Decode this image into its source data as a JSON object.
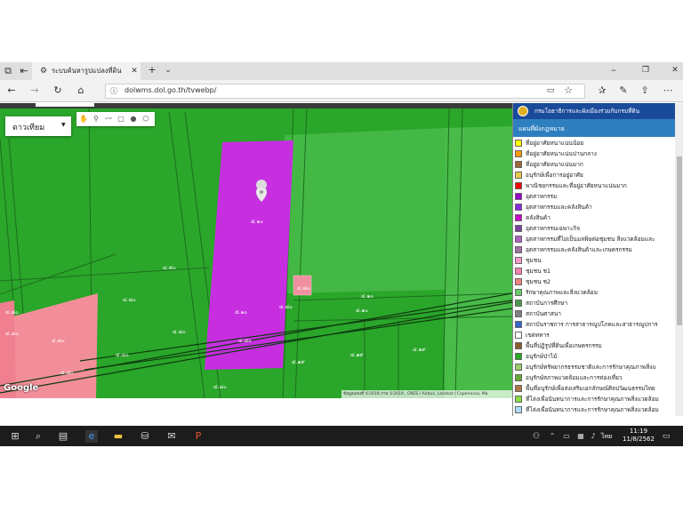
{
  "browser": {
    "tab_title": "ระบบค้นหารูปแปลงที่ดิน",
    "url": "dolwms.dol.go.th/tvwebp/"
  },
  "map": {
    "map_type_label": "ดาวเทียม",
    "google_label": "Google",
    "attribution": "ข้อมูลแผนที่ ©2019 ภาพ ©2019 , CNES / Airbus, Landsat / Copernicus, Ma",
    "plot_labels": [
      "๕.๑๐",
      "๔.๕๐",
      "๕.๑๐",
      "๔.๘๐",
      "๔.๘๐",
      "๔.๑๐",
      "๔.๑๐",
      "๔.๑๙",
      "๔.๑๙",
      "๔.๑๙",
      "๔.๑๙",
      "๔.๘๐",
      "๔.๘๐",
      "๔.๘๐",
      "๔.๘๐",
      "๔.๘๐",
      "๔.๘๐",
      "๔.๘๐",
      "๔.๘๐",
      "๔.๘๐"
    ]
  },
  "legend": {
    "header_title": "กรมโยธาธิการและผังเมืองร่วมกับกรมที่ดิน",
    "tab_label": "แผนที่ผังกฎหมาย",
    "items": [
      {
        "label": "ที่อยู่อาศัยหนาแน่นน้อย",
        "color": "#ffff00"
      },
      {
        "label": "ที่อยู่อาศัยหนาแน่นปานกลาง",
        "color": "#ff9900"
      },
      {
        "label": "ที่อยู่อาศัยหนาแน่นมาก",
        "color": "#996633"
      },
      {
        "label": "อนุรักษ์เพื่อการอยู่อาศัย",
        "color": "#e8c84a"
      },
      {
        "label": "พาณิชยกรรมและที่อยู่อาศัยหนาแน่นมาก",
        "color": "#ff0000"
      },
      {
        "label": "อุตสาหกรรม",
        "color": "#9900cc"
      },
      {
        "label": "อุตสาหกรรมและคลังสินค้า",
        "color": "#8a2be2"
      },
      {
        "label": "คลังสินค้า",
        "color": "#cc00cc"
      },
      {
        "label": "อุตสาหกรรมเฉพาะกิจ",
        "color": "#7b3f9e"
      },
      {
        "label": "อุตสาหกรรมที่ไม่เป็นมลพิษต่อชุมชน สิ่งแวดล้อมและ",
        "color": "#b060c0"
      },
      {
        "label": "อุตสาหกรรมและคลังสินค้าและเกษตรกรรม",
        "color": "#a070a0"
      },
      {
        "label": "ชุมชน",
        "color": "#ff99cc"
      },
      {
        "label": "ชุมชน ช1",
        "color": "#ff80b0"
      },
      {
        "label": "ชุมชน ช2",
        "color": "#f08080"
      },
      {
        "label": "รักษาคุณภาพและสิ่งแวดล้อม",
        "color": "#66cc66"
      },
      {
        "label": "สถาบันการศึกษา",
        "color": "#4a9a4a"
      },
      {
        "label": "สถาบันศาสนา",
        "color": "#808080"
      },
      {
        "label": "สถาบันราชการ การสาธารณูปโภคและสาธารณูปการ",
        "color": "#3366cc"
      },
      {
        "label": "เขตทหาร",
        "color": "#ffffff"
      },
      {
        "label": "พื้นที่ปฏิรูปที่ดินเพื่อเกษตรกรรม",
        "color": "#8b5a2b"
      },
      {
        "label": "อนุรักษ์ป่าไม้",
        "color": "#22aa22"
      },
      {
        "label": "อนุรักษ์ทรัพยากรธรรมชาติและการรักษาคุณภาพสิ่งแ",
        "color": "#99cc66"
      },
      {
        "label": "อนุรักษ์สภาพแวดล้อมและการท่องเที่ยว",
        "color": "#66aa33"
      },
      {
        "label": "พื้นที่อนุรักษ์เพื่อส่งเสริมเอกลักษณ์ศิลปวัฒนธรรมไทย",
        "color": "#aa7744"
      },
      {
        "label": "ที่โล่งเพื่อนันทนาการและการรักษาคุณภาพสิ่งแวดล้อม",
        "color": "#88dd44"
      },
      {
        "label": "ที่โล่งเพื่อนันทนาการและการรักษาคุณภาพสิ่งแวดล้อม",
        "color": "#aaddff"
      }
    ]
  },
  "taskbar": {
    "time": "11:19",
    "date": "11/8/2562",
    "lang": "ไทย"
  }
}
